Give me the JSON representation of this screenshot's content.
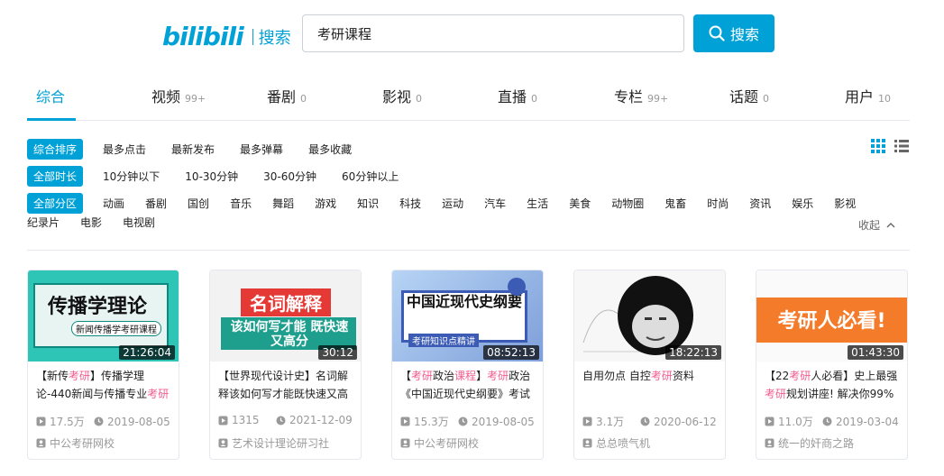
{
  "header": {
    "logo": "bilibili",
    "logo_suffix": "搜索",
    "search_value": "考研课程",
    "search_button": "搜索"
  },
  "tabs": [
    {
      "label": "综合",
      "count": ""
    },
    {
      "label": "视频",
      "count": "99+"
    },
    {
      "label": "番剧",
      "count": "0"
    },
    {
      "label": "影视",
      "count": "0"
    },
    {
      "label": "直播",
      "count": "0"
    },
    {
      "label": "专栏",
      "count": "99+"
    },
    {
      "label": "话题",
      "count": "0"
    },
    {
      "label": "用户",
      "count": "10"
    }
  ],
  "filters": {
    "order": [
      "综合排序",
      "最多点击",
      "最新发布",
      "最多弹幕",
      "最多收藏"
    ],
    "duration": [
      "全部时长",
      "10分钟以下",
      "10-30分钟",
      "30-60分钟",
      "60分钟以上"
    ],
    "zones_row1": [
      "全部分区",
      "动画",
      "番剧",
      "国创",
      "音乐",
      "舞蹈",
      "游戏",
      "知识",
      "科技",
      "运动",
      "汽车",
      "生活",
      "美食",
      "动物圈",
      "鬼畜",
      "时尚",
      "资讯",
      "娱乐",
      "影视"
    ],
    "zones_row2": [
      "纪录片",
      "电影",
      "电视剧"
    ],
    "collapse": "收起"
  },
  "colors": {
    "accent": "#00a1d6",
    "highlight": "#f25d8e"
  },
  "videos": [
    {
      "thumb_text": "传播学理论",
      "thumb_sub": "新闻传播学考研课程",
      "duration": "21:26:04",
      "title_parts": [
        [
          "【新传",
          ""
        ],
        [
          "考研",
          "hl"
        ],
        [
          "】传播学理论-440新闻与传播专业",
          ""
        ],
        [
          "考研",
          "hl"
        ]
      ],
      "plays": "17.5万",
      "date": "2019-08-05",
      "uploader": "中公考研网校"
    },
    {
      "thumb_text": "名词解释",
      "thumb_sub": "该如何写才能 既快速又高分",
      "duration": "30:12",
      "title_parts": [
        [
          "【世界现代设计史】名词解释该如何写才能既快速又高",
          ""
        ]
      ],
      "plays": "1315",
      "date": "2021-12-09",
      "uploader": "艺术设计理论研习社"
    },
    {
      "thumb_text": "中国近现代史纲要",
      "thumb_sub": "考研知识点精讲",
      "duration": "08:52:13",
      "title_parts": [
        [
          "【",
          ""
        ],
        [
          "考研",
          "hl"
        ],
        [
          "政治",
          ""
        ],
        [
          "课程",
          "hl"
        ],
        [
          "】",
          ""
        ],
        [
          "考研",
          "hl"
        ],
        [
          "政治《中国近现代史纲要》考试",
          ""
        ]
      ],
      "plays": "15.3万",
      "date": "2019-08-05",
      "uploader": "中公考研网校"
    },
    {
      "thumb_text": "",
      "thumb_sub": "",
      "duration": "18:22:13",
      "title_parts": [
        [
          "自用勿点 自控",
          ""
        ],
        [
          "考研",
          "hl"
        ],
        [
          "资料",
          ""
        ]
      ],
      "plays": "3.1万",
      "date": "2020-06-12",
      "uploader": "总总喷气机"
    },
    {
      "thumb_text": "考研人必看!",
      "thumb_sub": "",
      "duration": "01:43:30",
      "title_parts": [
        [
          "【22",
          ""
        ],
        [
          "考研",
          "hl"
        ],
        [
          "人必看】史上最强",
          ""
        ],
        [
          "考研",
          "hl"
        ],
        [
          "规划讲座! 解决你99%",
          ""
        ]
      ],
      "plays": "11.0万",
      "date": "2019-03-04",
      "uploader": "统一的奸商之路"
    }
  ]
}
